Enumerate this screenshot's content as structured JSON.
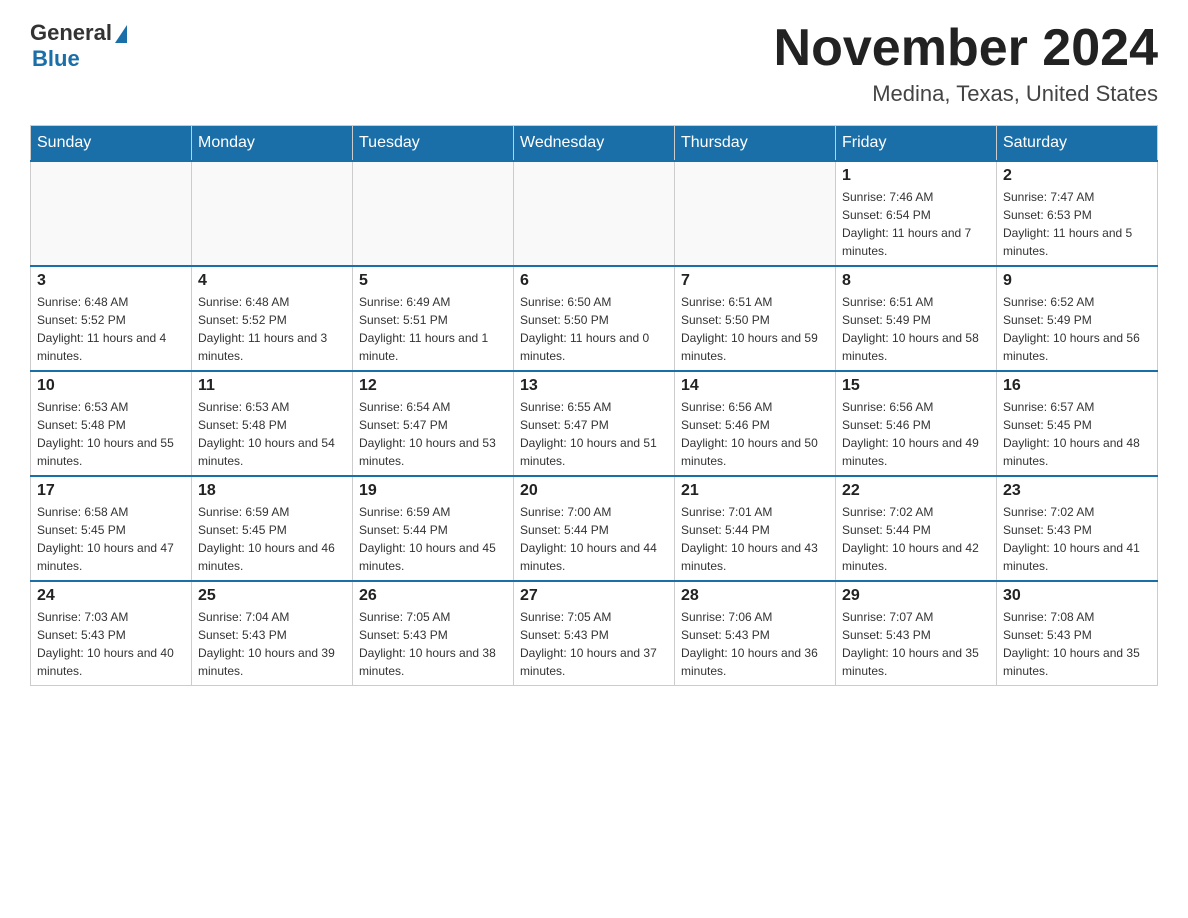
{
  "header": {
    "logo_general": "General",
    "logo_blue": "Blue",
    "title": "November 2024",
    "subtitle": "Medina, Texas, United States"
  },
  "days_of_week": [
    "Sunday",
    "Monday",
    "Tuesday",
    "Wednesday",
    "Thursday",
    "Friday",
    "Saturday"
  ],
  "weeks": [
    {
      "days": [
        {
          "num": "",
          "info": ""
        },
        {
          "num": "",
          "info": ""
        },
        {
          "num": "",
          "info": ""
        },
        {
          "num": "",
          "info": ""
        },
        {
          "num": "",
          "info": ""
        },
        {
          "num": "1",
          "info": "Sunrise: 7:46 AM\nSunset: 6:54 PM\nDaylight: 11 hours and 7 minutes."
        },
        {
          "num": "2",
          "info": "Sunrise: 7:47 AM\nSunset: 6:53 PM\nDaylight: 11 hours and 5 minutes."
        }
      ]
    },
    {
      "days": [
        {
          "num": "3",
          "info": "Sunrise: 6:48 AM\nSunset: 5:52 PM\nDaylight: 11 hours and 4 minutes."
        },
        {
          "num": "4",
          "info": "Sunrise: 6:48 AM\nSunset: 5:52 PM\nDaylight: 11 hours and 3 minutes."
        },
        {
          "num": "5",
          "info": "Sunrise: 6:49 AM\nSunset: 5:51 PM\nDaylight: 11 hours and 1 minute."
        },
        {
          "num": "6",
          "info": "Sunrise: 6:50 AM\nSunset: 5:50 PM\nDaylight: 11 hours and 0 minutes."
        },
        {
          "num": "7",
          "info": "Sunrise: 6:51 AM\nSunset: 5:50 PM\nDaylight: 10 hours and 59 minutes."
        },
        {
          "num": "8",
          "info": "Sunrise: 6:51 AM\nSunset: 5:49 PM\nDaylight: 10 hours and 58 minutes."
        },
        {
          "num": "9",
          "info": "Sunrise: 6:52 AM\nSunset: 5:49 PM\nDaylight: 10 hours and 56 minutes."
        }
      ]
    },
    {
      "days": [
        {
          "num": "10",
          "info": "Sunrise: 6:53 AM\nSunset: 5:48 PM\nDaylight: 10 hours and 55 minutes."
        },
        {
          "num": "11",
          "info": "Sunrise: 6:53 AM\nSunset: 5:48 PM\nDaylight: 10 hours and 54 minutes."
        },
        {
          "num": "12",
          "info": "Sunrise: 6:54 AM\nSunset: 5:47 PM\nDaylight: 10 hours and 53 minutes."
        },
        {
          "num": "13",
          "info": "Sunrise: 6:55 AM\nSunset: 5:47 PM\nDaylight: 10 hours and 51 minutes."
        },
        {
          "num": "14",
          "info": "Sunrise: 6:56 AM\nSunset: 5:46 PM\nDaylight: 10 hours and 50 minutes."
        },
        {
          "num": "15",
          "info": "Sunrise: 6:56 AM\nSunset: 5:46 PM\nDaylight: 10 hours and 49 minutes."
        },
        {
          "num": "16",
          "info": "Sunrise: 6:57 AM\nSunset: 5:45 PM\nDaylight: 10 hours and 48 minutes."
        }
      ]
    },
    {
      "days": [
        {
          "num": "17",
          "info": "Sunrise: 6:58 AM\nSunset: 5:45 PM\nDaylight: 10 hours and 47 minutes."
        },
        {
          "num": "18",
          "info": "Sunrise: 6:59 AM\nSunset: 5:45 PM\nDaylight: 10 hours and 46 minutes."
        },
        {
          "num": "19",
          "info": "Sunrise: 6:59 AM\nSunset: 5:44 PM\nDaylight: 10 hours and 45 minutes."
        },
        {
          "num": "20",
          "info": "Sunrise: 7:00 AM\nSunset: 5:44 PM\nDaylight: 10 hours and 44 minutes."
        },
        {
          "num": "21",
          "info": "Sunrise: 7:01 AM\nSunset: 5:44 PM\nDaylight: 10 hours and 43 minutes."
        },
        {
          "num": "22",
          "info": "Sunrise: 7:02 AM\nSunset: 5:44 PM\nDaylight: 10 hours and 42 minutes."
        },
        {
          "num": "23",
          "info": "Sunrise: 7:02 AM\nSunset: 5:43 PM\nDaylight: 10 hours and 41 minutes."
        }
      ]
    },
    {
      "days": [
        {
          "num": "24",
          "info": "Sunrise: 7:03 AM\nSunset: 5:43 PM\nDaylight: 10 hours and 40 minutes."
        },
        {
          "num": "25",
          "info": "Sunrise: 7:04 AM\nSunset: 5:43 PM\nDaylight: 10 hours and 39 minutes."
        },
        {
          "num": "26",
          "info": "Sunrise: 7:05 AM\nSunset: 5:43 PM\nDaylight: 10 hours and 38 minutes."
        },
        {
          "num": "27",
          "info": "Sunrise: 7:05 AM\nSunset: 5:43 PM\nDaylight: 10 hours and 37 minutes."
        },
        {
          "num": "28",
          "info": "Sunrise: 7:06 AM\nSunset: 5:43 PM\nDaylight: 10 hours and 36 minutes."
        },
        {
          "num": "29",
          "info": "Sunrise: 7:07 AM\nSunset: 5:43 PM\nDaylight: 10 hours and 35 minutes."
        },
        {
          "num": "30",
          "info": "Sunrise: 7:08 AM\nSunset: 5:43 PM\nDaylight: 10 hours and 35 minutes."
        }
      ]
    }
  ]
}
